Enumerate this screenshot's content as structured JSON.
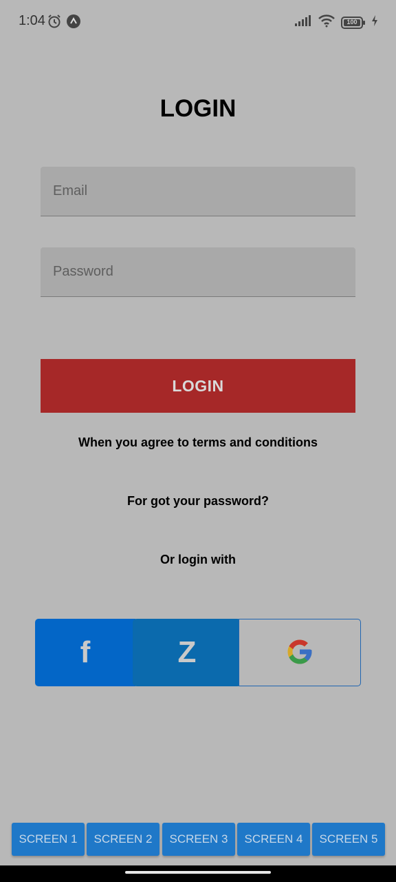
{
  "status_bar": {
    "time": "1:04",
    "left_icons": [
      "alarm-icon",
      "app-notification-icon"
    ],
    "right_icons": [
      "signal-icon",
      "wifi-icon",
      "battery-icon",
      "charging-icon"
    ],
    "battery_level": "100"
  },
  "login": {
    "title": "LOGIN",
    "email_placeholder": "Email",
    "password_placeholder": "Password",
    "button_label": "LOGIN",
    "terms_text": "When you agree to terms and conditions",
    "forgot_text": "For got your password?",
    "or_login_text": "Or login with"
  },
  "social": {
    "facebook_label": "f",
    "zalo_label": "Z",
    "google_icon": "google-icon"
  },
  "tabs": [
    "SCREEN 1",
    "SCREEN 2",
    "SCREEN 3",
    "SCREEN 4",
    "SCREEN 5"
  ],
  "colors": {
    "login_button": "#a62828",
    "facebook": "#0366c7",
    "zalo": "#0b6aad",
    "tab": "#1f78c8"
  }
}
